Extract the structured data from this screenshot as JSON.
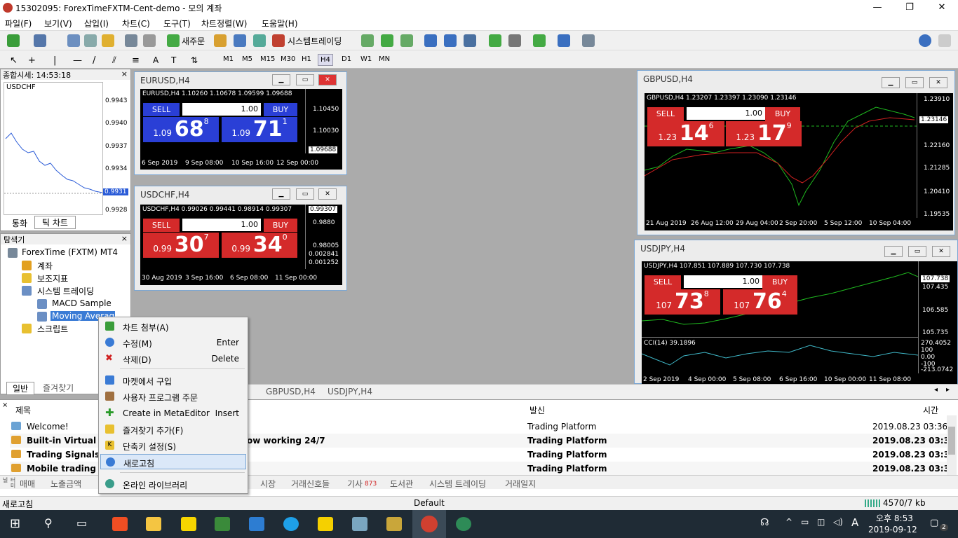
{
  "window": {
    "title": "15302095: ForexTimeFXTM-Cent-demo - 모의 계좌",
    "min": "—",
    "max": "❐",
    "close": "✕"
  },
  "menu": [
    "파일(F)",
    "보기(V)",
    "삽입(I)",
    "차트(C)",
    "도구(T)",
    "차트정렬(W)",
    "도움말(H)"
  ],
  "toolbar": {
    "new_order": "새주문",
    "autotrading": "시스템트레이딩"
  },
  "timeframes": [
    "M1",
    "M5",
    "M15",
    "M30",
    "H1",
    "H4",
    "D1",
    "W1",
    "MN"
  ],
  "market_watch": {
    "title": "종합시세: 14:53:18",
    "symbol": "USDCHF",
    "prices": [
      "0.9943",
      "0.9940",
      "0.9937",
      "0.9934",
      "0.9931",
      "0.9928"
    ],
    "current": "0.9931",
    "tabs": [
      "통화",
      "틱 차트"
    ]
  },
  "navigator": {
    "title": "탐색기",
    "root": "ForexTime (FXTM) MT4",
    "items": [
      "계좌",
      "보조지표",
      "시스템 트레이딩",
      "MACD Sample",
      "Moving Average",
      "스크립트"
    ],
    "tabs": [
      "일반",
      "즐겨찾기"
    ]
  },
  "charts": [
    {
      "title": "EURUSD,H4",
      "info": "EURUSD,H4  1.10260 1.10678 1.09599 1.09688",
      "sell": "SELL",
      "buy": "BUY",
      "lot": "1.00",
      "sell_small": "1.09",
      "sell_big": "68",
      "sell_sup": "8",
      "buy_small": "1.09",
      "buy_big": "71",
      "buy_sup": "1",
      "y": [
        "1.10450",
        "1.10030",
        "1.09688",
        "1.09630"
      ],
      "x": [
        "6 Sep 2019",
        "9 Sep 08:00",
        "10 Sep 16:00",
        "12 Sep 00:00"
      ]
    },
    {
      "title": "USDCHF,H4",
      "info": "USDCHF,H4  0.99026 0.99441 0.98914 0.99307",
      "sell": "SELL",
      "buy": "BUY",
      "lot": "1.00",
      "sell_small": "0.99",
      "sell_big": "30",
      "sell_sup": "7",
      "buy_small": "0.99",
      "buy_big": "34",
      "buy_sup": "0",
      "y": [
        "0.99307",
        "0.9880",
        "0.98005",
        "0.002841",
        "0.001252"
      ],
      "x": [
        "30 Aug 2019",
        "3 Sep 16:00",
        "6 Sep 08:00",
        "11 Sep 00:00"
      ]
    },
    {
      "title": "GBPUSD,H4",
      "info": "GBPUSD,H4  1.23207 1.23397 1.23090 1.23146",
      "sell": "SELL",
      "buy": "BUY",
      "lot": "1.00",
      "sell_small": "1.23",
      "sell_big": "14",
      "sell_sup": "6",
      "buy_small": "1.23",
      "buy_big": "17",
      "buy_sup": "9",
      "y": [
        "1.23910",
        "1.23146",
        "1.22160",
        "1.21285",
        "1.20410",
        "1.19535"
      ],
      "x": [
        "21 Aug 2019",
        "26 Aug 12:00",
        "29 Aug 04:00",
        "2 Sep 20:00",
        "5 Sep 12:00",
        "10 Sep 04:00"
      ]
    },
    {
      "title": "USDJPY,H4",
      "info": "USDJPY,H4  107.851 107.889 107.730 107.738",
      "sell": "SELL",
      "buy": "BUY",
      "lot": "1.00",
      "sell_small": "107",
      "sell_big": "73",
      "sell_sup": "8",
      "buy_small": "107",
      "buy_big": "76",
      "buy_sup": "4",
      "y": [
        "107.738",
        "107.435",
        "106.585",
        "105.735"
      ],
      "cci": "CCI(14) 39.1896",
      "cci_y": [
        "270.4052",
        "100",
        "0.00",
        "-100",
        "-213.0742"
      ],
      "x": [
        "2 Sep 2019",
        "4 Sep 00:00",
        "5 Sep 08:00",
        "6 Sep 16:00",
        "10 Sep 00:00",
        "11 Sep 08:00"
      ]
    }
  ],
  "chart_tabs": [
    "GBPUSD,H4",
    "USDJPY,H4"
  ],
  "terminal": {
    "cols": [
      "제목",
      "발신",
      "시간"
    ],
    "rows": [
      {
        "title": "Welcome!",
        "title2": "",
        "from": "Trading Platform",
        "time": "2019.08.23 03:36",
        "bold": false
      },
      {
        "title": "Built-in Virtual Ho",
        "title2": "ow working 24/7",
        "from": "Trading Platform",
        "time": "2019.08.23 03:36",
        "bold": true
      },
      {
        "title": "Trading Signals a",
        "title2": "",
        "from": "Trading Platform",
        "time": "2019.08.23 03:36",
        "bold": true
      },
      {
        "title": "Mobile trading ?",
        "title2": "",
        "from": "Trading Platform",
        "time": "2019.08.23 03:36",
        "bold": true
      }
    ]
  },
  "bottom_tabs": [
    "매매",
    "노출금액",
    "시장",
    "거래신호들",
    "기사",
    "도서관",
    "시스템 트레이딩",
    "거래일지"
  ],
  "news_badge": "873",
  "terminal_side": "터미널",
  "status": {
    "left": "새로고침",
    "profile": "Default",
    "traffic": "4570/7 kb"
  },
  "context_menu": [
    {
      "label": "차트 첨부(A)",
      "shortcut": ""
    },
    {
      "label": "수정(M)",
      "shortcut": "Enter"
    },
    {
      "label": "삭제(D)",
      "shortcut": "Delete"
    },
    {
      "label": "마켓에서 구입",
      "shortcut": ""
    },
    {
      "label": "사용자 프로그램 주문",
      "shortcut": ""
    },
    {
      "label": "Create in MetaEditor",
      "shortcut": "Insert"
    },
    {
      "label": "즐겨찾기 추가(F)",
      "shortcut": ""
    },
    {
      "label": "단축키 설정(S)",
      "shortcut": ""
    },
    {
      "label": "새로고침",
      "shortcut": ""
    },
    {
      "label": "온라인 라이브러리",
      "shortcut": ""
    }
  ],
  "clock": {
    "time": "오후 8:53",
    "date": "2019-09-12",
    "ime": "A",
    "notif": "2"
  }
}
